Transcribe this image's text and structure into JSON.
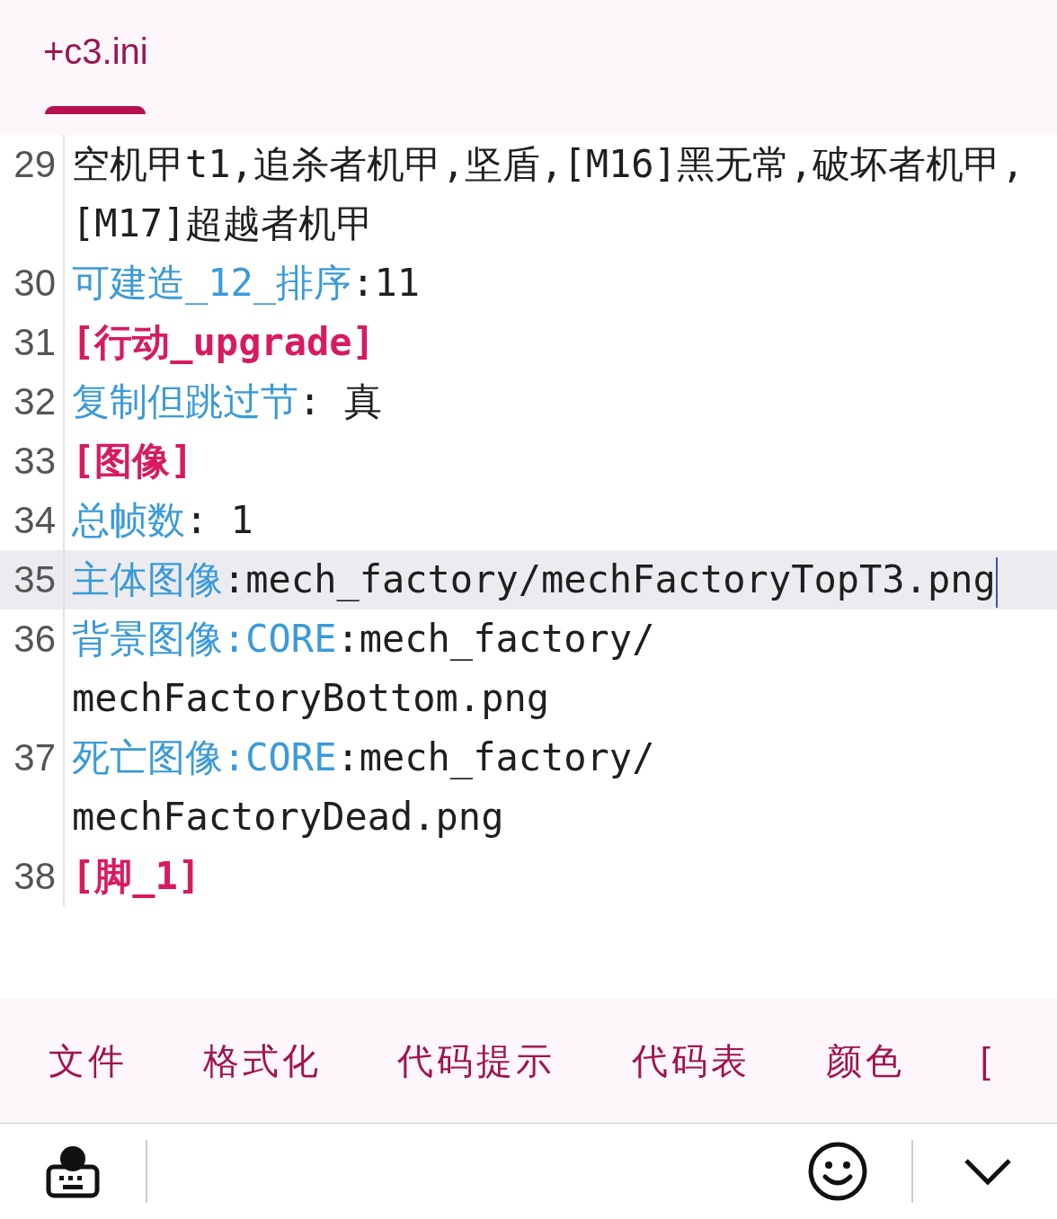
{
  "tabs": [
    {
      "label": "+c3.ini",
      "selected": true
    }
  ],
  "editor": {
    "lines": [
      {
        "number": "29",
        "current": false,
        "segments": [
          {
            "kind": "value",
            "text": "空机甲t1,追杀者机甲,坚盾,[M16]黑无常,破坏者机甲,[M17]超越者机甲"
          }
        ]
      },
      {
        "number": "30",
        "current": false,
        "segments": [
          {
            "kind": "key",
            "text": "可建造_12_排序"
          },
          {
            "kind": "value",
            "text": ":11"
          }
        ]
      },
      {
        "number": "31",
        "current": false,
        "segments": [
          {
            "kind": "section",
            "text": "[行动_upgrade]"
          }
        ]
      },
      {
        "number": "32",
        "current": false,
        "segments": [
          {
            "kind": "key",
            "text": "复制但跳过节"
          },
          {
            "kind": "value",
            "text": ": 真"
          }
        ]
      },
      {
        "number": "33",
        "current": false,
        "segments": [
          {
            "kind": "section",
            "text": "[图像]"
          }
        ]
      },
      {
        "number": "34",
        "current": false,
        "segments": [
          {
            "kind": "key",
            "text": "总帧数"
          },
          {
            "kind": "value",
            "text": ": 1"
          }
        ]
      },
      {
        "number": "35",
        "current": true,
        "segments": [
          {
            "kind": "key",
            "text": "主体图像"
          },
          {
            "kind": "value",
            "text": ":mech_factory/mechFactoryTopT3.png"
          }
        ]
      },
      {
        "number": "36",
        "current": false,
        "segments": [
          {
            "kind": "key",
            "text": "背景图像:CORE"
          },
          {
            "kind": "value",
            "text": ":mech_factory/mechFactoryBottom.png"
          }
        ]
      },
      {
        "number": "37",
        "current": false,
        "segments": [
          {
            "kind": "key",
            "text": "死亡图像:CORE"
          },
          {
            "kind": "value",
            "text": ":mech_factory/mechFactoryDead.png"
          }
        ]
      },
      {
        "number": "38",
        "current": false,
        "segments": [
          {
            "kind": "section",
            "text": "[脚_1]"
          }
        ]
      }
    ]
  },
  "toolbar": [
    "文件",
    "格式化",
    "代码提示",
    "代码表",
    "颜色",
    "["
  ]
}
